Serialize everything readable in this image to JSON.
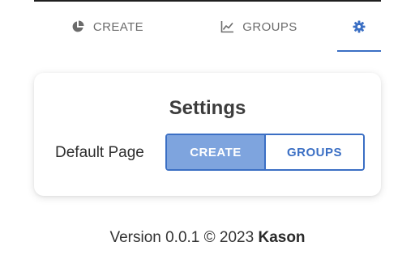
{
  "tabs": [
    {
      "label": "CREATE",
      "icon": "pie-chart-icon"
    },
    {
      "label": "GROUPS",
      "icon": "line-chart-icon"
    },
    {
      "label": "",
      "icon": "gear-icon",
      "active": true
    }
  ],
  "settings": {
    "title": "Settings",
    "default_page_label": "Default Page",
    "options": [
      {
        "label": "CREATE",
        "selected": true
      },
      {
        "label": "GROUPS",
        "selected": false
      }
    ]
  },
  "footer": {
    "version_text": "Version 0.0.1 © 2023",
    "author": "Kason"
  },
  "colors": {
    "accent": "#3b6fc4",
    "selected_fill": "#7ea4de",
    "tab_text": "#6b6b6b"
  }
}
